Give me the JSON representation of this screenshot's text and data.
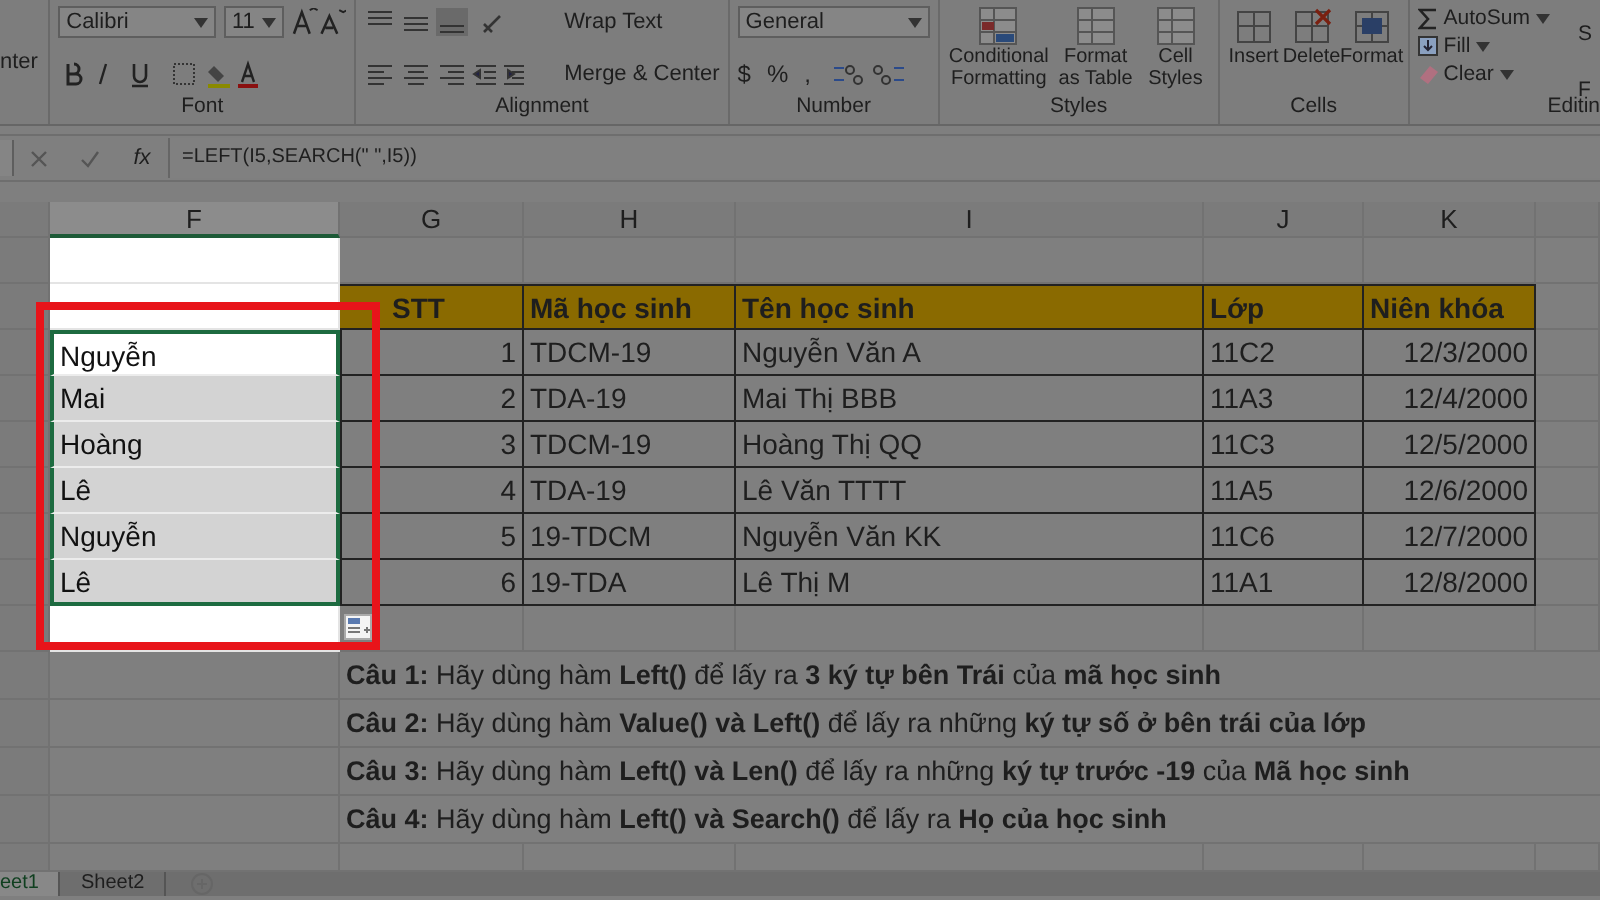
{
  "ribbon": {
    "cut_label": "nter",
    "font": {
      "family": "Calibri",
      "size": "11",
      "label": "Font"
    },
    "alignment": {
      "wrap": "Wrap Text",
      "merge": "Merge & Center",
      "label": "Alignment"
    },
    "number": {
      "format": "General",
      "currency": "$",
      "percent": "%",
      "comma": ",",
      "label": "Number"
    },
    "styles": {
      "items": [
        "Conditional Formatting",
        "Format as Table",
        "Cell Styles"
      ],
      "label": "Styles"
    },
    "cells": {
      "items": [
        "Insert",
        "Delete",
        "Format"
      ],
      "label": "Cells"
    },
    "editing": {
      "items": [
        "AutoSum",
        "Fill",
        "Clear"
      ],
      "label": "Editin",
      "cut_items": [
        "S",
        "F"
      ]
    }
  },
  "formula_bar": {
    "fx": "fx",
    "formula": "=LEFT(I5,SEARCH(\" \",I5))"
  },
  "columns": [
    {
      "label": "F",
      "selected": true
    },
    {
      "label": "G",
      "selected": false
    },
    {
      "label": "H",
      "selected": false
    },
    {
      "label": "I",
      "selected": false
    },
    {
      "label": "J",
      "selected": false
    },
    {
      "label": "K",
      "selected": false
    }
  ],
  "table": {
    "headers": [
      "STT",
      "Mã học sinh",
      "Tên học sinh",
      "Lớp",
      "Niên khóa"
    ],
    "rows": [
      [
        "1",
        "TDCM-19",
        "Nguyễn Văn A",
        "11C2",
        "12/3/2000"
      ],
      [
        "2",
        "TDA-19",
        "Mai Thị BBB",
        "11A3",
        "12/4/2000"
      ],
      [
        "3",
        "TDCM-19",
        "Hoàng Thị QQ",
        "11C3",
        "12/5/2000"
      ],
      [
        "4",
        "TDA-19",
        "Lê Văn TTTT",
        "11A5",
        "12/6/2000"
      ],
      [
        "5",
        "19-TDCM",
        "Nguyễn Văn KK",
        "11C6",
        "12/7/2000"
      ],
      [
        "6",
        "19-TDA",
        "Lê Thị M",
        "11A1",
        "12/8/2000"
      ]
    ]
  },
  "f_cells": [
    {
      "text": "Nguyễn",
      "active": true
    },
    {
      "text": "Mai",
      "active": false
    },
    {
      "text": "Hoàng",
      "active": false
    },
    {
      "text": "Lê",
      "active": false
    },
    {
      "text": "Nguyễn",
      "active": false
    },
    {
      "text": "Lê",
      "active": false
    }
  ],
  "questions": [
    "**Câu 1:** Hãy dùng hàm **Left()** để lấy ra **3 ký tự bên Trái** của **mã học sinh**",
    "**Câu 2:** Hãy dùng hàm **Value() và Left()** để lấy ra những **ký tự số ở bên trái của lớp**",
    "**Câu 3:** Hãy dùng hàm **Left() và Len()** để lấy ra  những **ký tự trước -19** của **Mã học sinh**",
    "**Câu 4:** Hãy dùng hàm **Left() và Search()** để lấy ra **Họ của học sinh**"
  ],
  "sheet_tabs": [
    {
      "label": "eet1",
      "selected": true
    },
    {
      "label": "Sheet2",
      "selected": false
    }
  ]
}
